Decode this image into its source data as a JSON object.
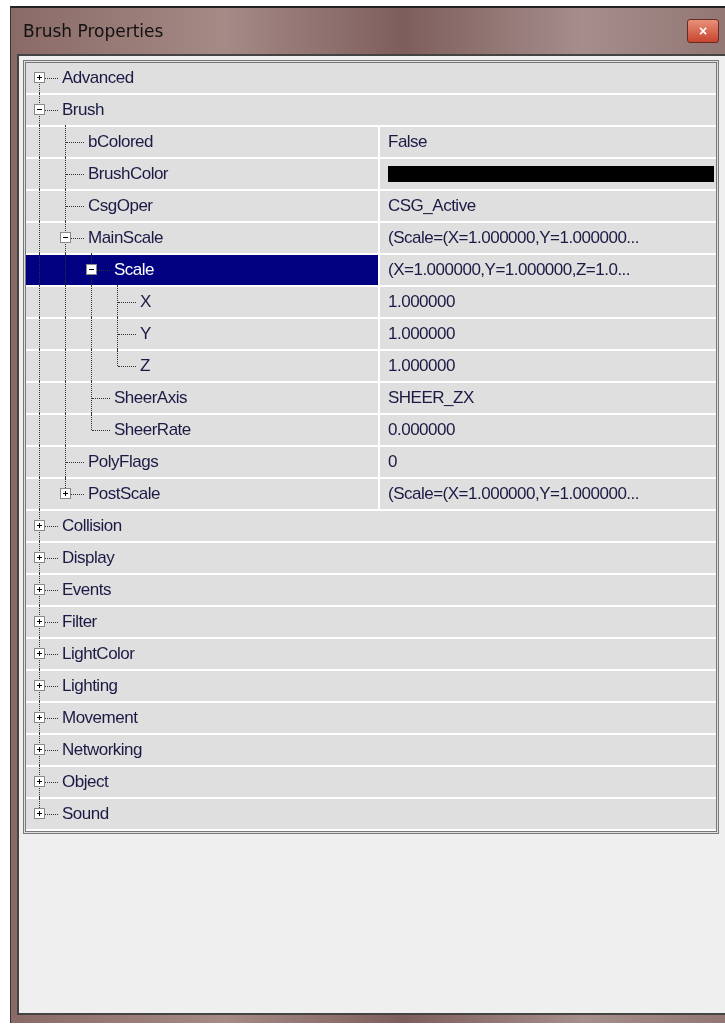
{
  "window": {
    "title": "Brush Properties",
    "close_label": "×"
  },
  "properties": [
    {
      "name": "Advanced",
      "kind": "category",
      "expanded": false,
      "selected": false
    },
    {
      "name": "Brush",
      "kind": "category",
      "expanded": true,
      "selected": false,
      "children": [
        {
          "name": "bColored",
          "kind": "property",
          "value": "False",
          "selected": false
        },
        {
          "name": "BrushColor",
          "kind": "color",
          "color": "#000000",
          "selected": false
        },
        {
          "name": "CsgOper",
          "kind": "property",
          "value": "CSG_Active",
          "selected": false
        },
        {
          "name": "MainScale",
          "kind": "property",
          "value": "(Scale=(X=1.000000,Y=1.000000...",
          "expanded": true,
          "selected": false,
          "children": [
            {
              "name": "Scale",
              "kind": "property",
              "value": "(X=1.000000,Y=1.000000,Z=1.0...",
              "expanded": true,
              "selected": true,
              "children": [
                {
                  "name": "X",
                  "kind": "property",
                  "value": "1.000000",
                  "selected": false
                },
                {
                  "name": "Y",
                  "kind": "property",
                  "value": "1.000000",
                  "selected": false
                },
                {
                  "name": "Z",
                  "kind": "property",
                  "value": "1.000000",
                  "selected": false
                }
              ]
            },
            {
              "name": "SheerAxis",
              "kind": "property",
              "value": "SHEER_ZX",
              "selected": false
            },
            {
              "name": "SheerRate",
              "kind": "property",
              "value": "0.000000",
              "selected": false
            }
          ]
        },
        {
          "name": "PolyFlags",
          "kind": "property",
          "value": "0",
          "selected": false
        },
        {
          "name": "PostScale",
          "kind": "property",
          "value": "(Scale=(X=1.000000,Y=1.000000...",
          "expanded": false,
          "selected": false
        }
      ]
    },
    {
      "name": "Collision",
      "kind": "category",
      "expanded": false,
      "selected": false
    },
    {
      "name": "Display",
      "kind": "category",
      "expanded": false,
      "selected": false
    },
    {
      "name": "Events",
      "kind": "category",
      "expanded": false,
      "selected": false
    },
    {
      "name": "Filter",
      "kind": "category",
      "expanded": false,
      "selected": false
    },
    {
      "name": "LightColor",
      "kind": "category",
      "expanded": false,
      "selected": false
    },
    {
      "name": "Lighting",
      "kind": "category",
      "expanded": false,
      "selected": false
    },
    {
      "name": "Movement",
      "kind": "category",
      "expanded": false,
      "selected": false
    },
    {
      "name": "Networking",
      "kind": "category",
      "expanded": false,
      "selected": false
    },
    {
      "name": "Object",
      "kind": "category",
      "expanded": false,
      "selected": false
    },
    {
      "name": "Sound",
      "kind": "category",
      "expanded": false,
      "selected": false
    }
  ]
}
